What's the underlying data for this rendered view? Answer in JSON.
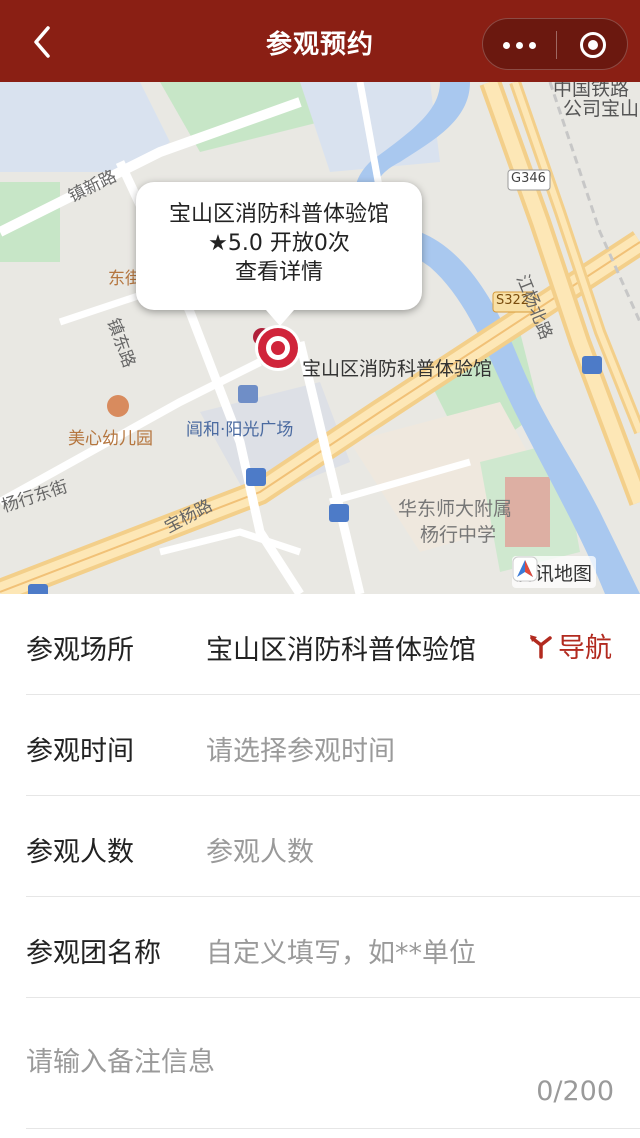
{
  "header": {
    "title": "参观预约",
    "back_icon": "chevron-left-icon",
    "more_icon": "more-dots-icon",
    "close_icon": "target-close-icon",
    "background": "#8a1f14"
  },
  "map": {
    "labels": {
      "railway_corp": "中国铁路",
      "railway_corp2": "公司宝山",
      "zhenxin_road": "镇新路",
      "g346": "G346",
      "s322": "S322",
      "jiangyang_north": "江杨北路",
      "zhendong_road": "镇东路",
      "dong_partial": "东街",
      "poi_pin_label": "宝山区消防科普体验馆",
      "meixin_kindergarten": "美心幼儿园",
      "yanghe_plaza": "阊和·阳光广场",
      "yangxing_east": "杨行东街",
      "baoyang_road": "宝杨路",
      "ecnu_school_1": "华东师大附属",
      "ecnu_school_2": "杨行中学"
    },
    "bubble": {
      "name": "宝山区消防科普体验馆",
      "stats": "★5.0  开放0次",
      "detail": "查看详情"
    },
    "provider": "腾讯地图",
    "pin_color": "#d0243a"
  },
  "form": {
    "venue_label": "参观场所",
    "venue_value": "宝山区消防科普体验馆",
    "nav_label": "导航",
    "nav_icon": "navigation-fork-icon",
    "time_label": "参观时间",
    "time_placeholder": "请选择参观时间",
    "count_label": "参观人数",
    "count_placeholder": "参观人数",
    "group_label": "参观团名称",
    "group_placeholder": "自定义填写，如**单位",
    "remark_placeholder": "请输入备注信息",
    "remark_counter": "0/200",
    "accent": "#b22a1f"
  }
}
